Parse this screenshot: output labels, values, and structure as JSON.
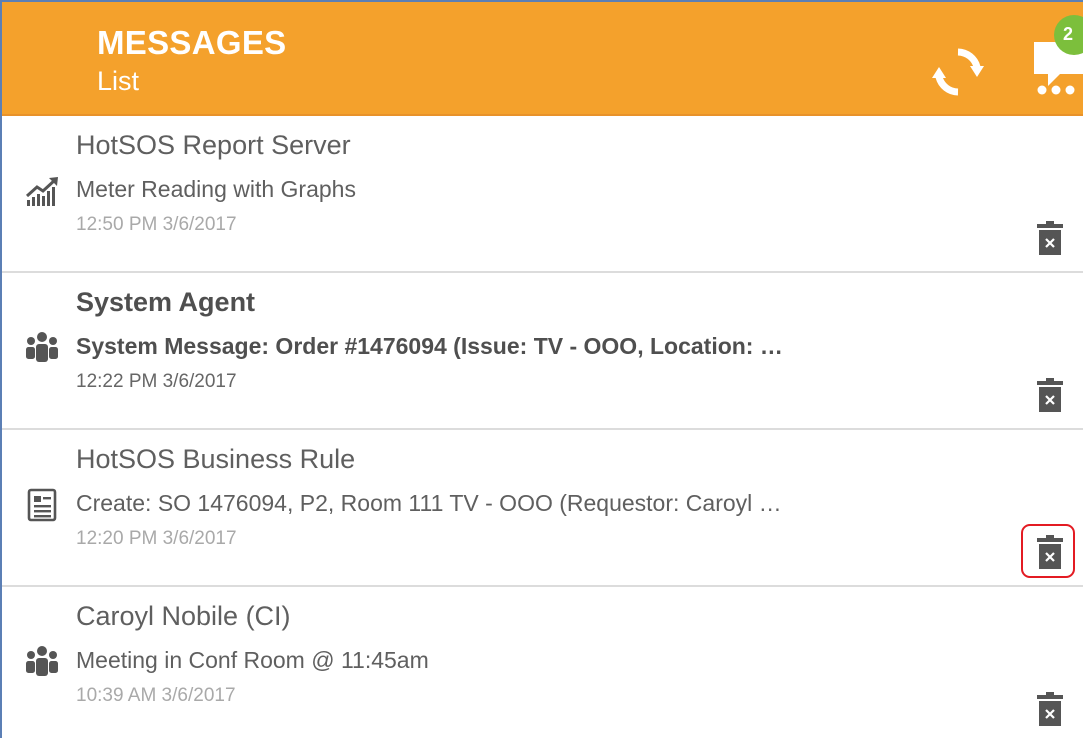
{
  "header": {
    "title": "MESSAGES",
    "subtitle": "List",
    "refresh_icon": "refresh-icon",
    "chat_icon": "chat-bubble-icon",
    "unread_badge": "2",
    "background_color": "#f4a12c",
    "badge_color": "#7cbf3c"
  },
  "messages": [
    {
      "sender": "HotSOS Report Server",
      "subject": "Meter Reading with Graphs",
      "time": "12:50 PM 3/6/2017",
      "icon": "chart-trend-icon",
      "unread": false
    },
    {
      "sender": "System Agent",
      "subject": "System Message: Order #1476094 (Issue: TV - OOO, Location: …",
      "time": "12:22 PM 3/6/2017",
      "icon": "group-icon",
      "unread": true
    },
    {
      "sender": "HotSOS Business Rule",
      "subject": "Create: SO 1476094, P2, Room 111 TV - OOO (Requestor: Caroyl …",
      "time": "12:20 PM 3/6/2017",
      "icon": "document-icon",
      "unread": false,
      "delete_highlighted": true
    },
    {
      "sender": "Caroyl Nobile (CI)",
      "subject": "Meeting in Conf Room @ 11:45am",
      "time": "10:39 AM 3/6/2017",
      "icon": "group-icon",
      "unread": false
    }
  ],
  "delete_icon": "trash-icon",
  "highlight_color": "#e31b23"
}
